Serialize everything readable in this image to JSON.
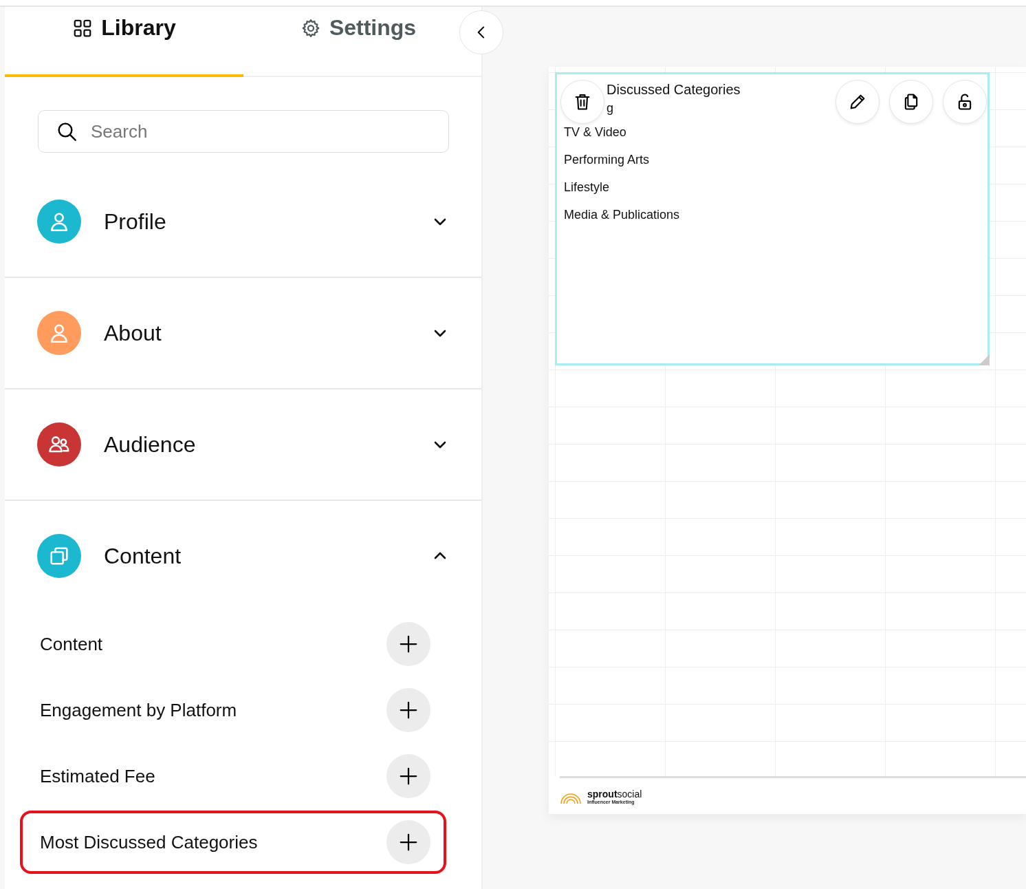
{
  "tabs": [
    {
      "label": "Library",
      "selected": true
    },
    {
      "label": "Settings",
      "selected": false
    }
  ],
  "search": {
    "placeholder": "Search"
  },
  "sections": [
    {
      "label": "Profile",
      "color": "#1bb8cf",
      "expanded": false
    },
    {
      "label": "About",
      "color": "#ff9b5c",
      "expanded": false
    },
    {
      "label": "Audience",
      "color": "#c93535",
      "expanded": false
    },
    {
      "label": "Content",
      "color": "#1bb8cf",
      "expanded": true,
      "items": [
        {
          "label": "Content",
          "highlighted": false
        },
        {
          "label": "Engagement by Platform",
          "highlighted": false
        },
        {
          "label": "Estimated Fee",
          "highlighted": false
        },
        {
          "label": "Most Discussed Categories",
          "highlighted": true
        }
      ]
    }
  ],
  "widget": {
    "title": "Discussed Categories",
    "rows": [
      "g",
      "TV & Video",
      "Performing Arts",
      "Lifestyle",
      "Media & Publications"
    ],
    "selected": true
  },
  "footer": {
    "brand_bold": "sprout",
    "brand_light": "social",
    "tagline": "Influencer Marketing"
  }
}
